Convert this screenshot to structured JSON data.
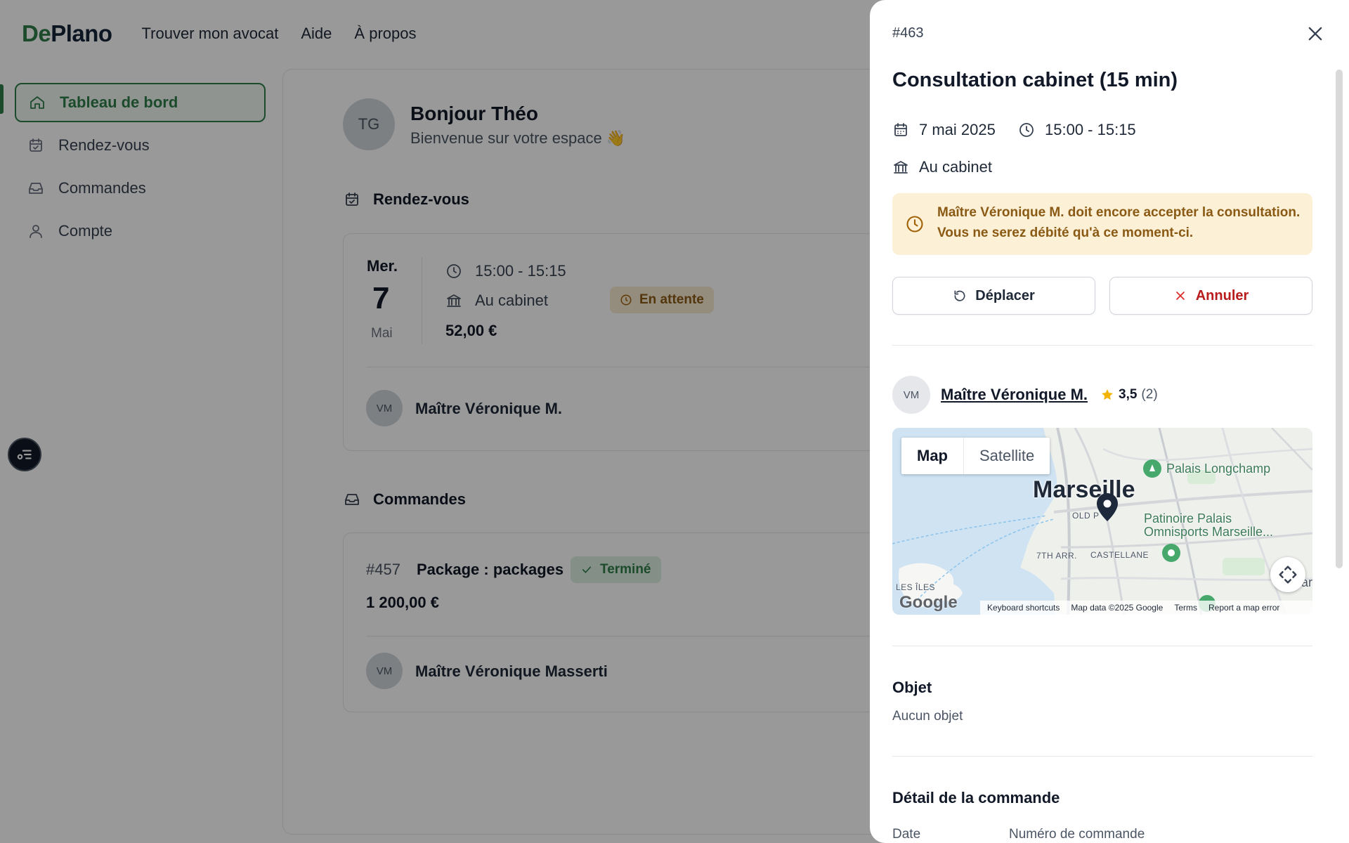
{
  "brand": {
    "de": "De",
    "plano": "Plano",
    "green": "#2f7d4a"
  },
  "nav": {
    "find_lawyer": "Trouver mon avocat",
    "help": "Aide",
    "about": "À propos"
  },
  "sidebar": {
    "items": [
      {
        "label": "Tableau de bord",
        "icon": "home-icon",
        "active": true
      },
      {
        "label": "Rendez-vous",
        "icon": "calendar-icon"
      },
      {
        "label": "Commandes",
        "icon": "inbox-icon"
      },
      {
        "label": "Compte",
        "icon": "user-icon"
      }
    ]
  },
  "greeting": {
    "initials": "TG",
    "title": "Bonjour Théo",
    "subtitle": "Bienvenue sur votre espace 👋"
  },
  "appointments": {
    "heading": "Rendez-vous",
    "item": {
      "dow": "Mer.",
      "day": "7",
      "month": "Mai",
      "time": "15:00 - 15:15",
      "place": "Au cabinet",
      "price": "52,00 €",
      "status": "En attente",
      "lawyer_initials": "VM",
      "lawyer_name": "Maître Véronique M."
    }
  },
  "orders": {
    "heading": "Commandes",
    "item": {
      "number": "#457",
      "title": "Package : packages",
      "status": "Terminé",
      "price": "1 200,00 €",
      "lawyer_initials": "VM",
      "lawyer_name": "Maître Véronique Masserti"
    }
  },
  "drawer": {
    "id": "#463",
    "title": "Consultation cabinet (15 min)",
    "date": "7 mai 2025",
    "time": "15:00 - 15:15",
    "place": "Au cabinet",
    "alert_line1": "Maître Véronique M. doit encore accepter la consultation.",
    "alert_line2": "Vous ne serez débité qu'à ce moment-ci.",
    "move_label": "Déplacer",
    "cancel_label": "Annuler",
    "lawyer_initials": "VM",
    "lawyer_name": "Maître Véronique M.",
    "rating": "3,5",
    "rating_count": "(2)",
    "map": {
      "tab_map": "Map",
      "tab_satellite": "Satellite",
      "city": "Marseille",
      "labels": {
        "old_port": "OLD P",
        "seventh": "7TH ARR.",
        "castellane": "CASTELLANE",
        "les_iles": "LES ÎLES",
        "longchamp": "Palais Longchamp",
        "patinoire1": "Patinoire Palais",
        "patinoire2": "Omnisports Marseille...",
        "gare": "are"
      },
      "google": "Google",
      "shortcuts": "Keyboard shortcuts",
      "map_data": "Map data ©2025 Google",
      "terms": "Terms",
      "report": "Report a map error"
    },
    "object_heading": "Objet",
    "object_value": "Aucun objet",
    "order_detail_heading": "Détail de la commande",
    "col_date": "Date",
    "col_order_number": "Numéro de commande"
  }
}
